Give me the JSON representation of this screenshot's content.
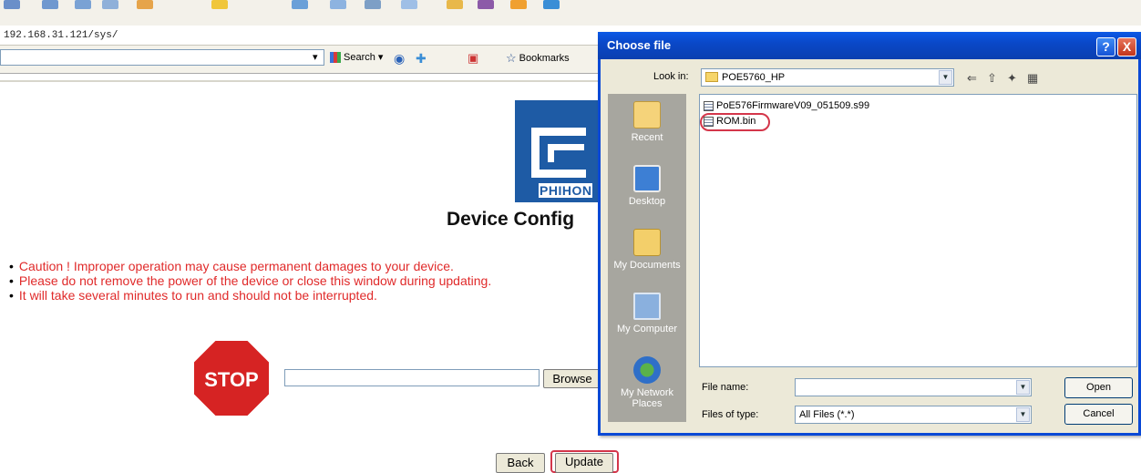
{
  "browser": {
    "address": "192.168.31.121/sys/",
    "toolbar": {
      "search_label": "Search",
      "bookmarks_label": "Bookmarks"
    }
  },
  "page": {
    "logo_text": "PHIHON",
    "heading": "Device Config",
    "cautions": [
      "Caution !  Improper operation may cause permanent damages to your device.",
      "Please do not remove the power of the device or close this window during updating.",
      "It will take several minutes to run and should not be interrupted."
    ],
    "stop_sign": "STOP",
    "file_path": "",
    "browse_label": "Browse",
    "back_label": "Back",
    "update_label": "Update"
  },
  "dialog": {
    "title": "Choose file",
    "help_glyph": "?",
    "close_glyph": "X",
    "look_in_label": "Look in:",
    "look_in_value": "POE5760_HP",
    "places": [
      {
        "label": "Recent",
        "icon": "recent-folder-icon"
      },
      {
        "label": "Desktop",
        "icon": "desktop-icon"
      },
      {
        "label": "My Documents",
        "icon": "my-documents-icon"
      },
      {
        "label": "My Computer",
        "icon": "my-computer-icon"
      },
      {
        "label": "My Network Places",
        "icon": "network-icon"
      }
    ],
    "files": [
      "PoE576FirmwareV09_051509.s99",
      "ROM.bin"
    ],
    "file_name_label": "File name:",
    "file_name_value": "",
    "file_type_label": "Files of type:",
    "file_type_value": "All Files (*.*)",
    "open_label": "Open",
    "cancel_label": "Cancel"
  },
  "colors": {
    "caution_red": "#e02a2a",
    "highlight_ring": "#d4364a",
    "dialog_blue": "#0a49d6",
    "logo_blue": "#1e5ba5"
  }
}
